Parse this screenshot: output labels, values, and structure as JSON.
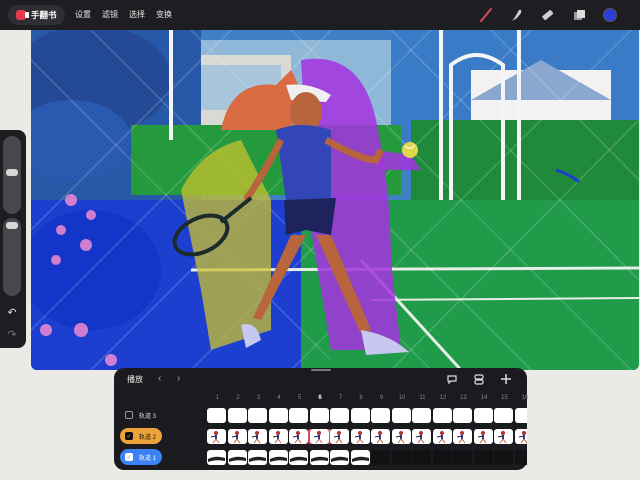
{
  "app": {
    "title": "手翻书"
  },
  "menu": [
    "设置",
    "滤镜",
    "选择",
    "变换"
  ],
  "tools": {
    "brush": {
      "icon": "brush-icon",
      "color": "#e0455e"
    },
    "smudge": {
      "icon": "smudge-icon"
    },
    "eraser": {
      "icon": "eraser-icon"
    },
    "layers": {
      "icon": "layers-icon"
    },
    "color": {
      "icon": "color-swatch",
      "value": "#2b3fd6"
    }
  },
  "timeline": {
    "title": "播放",
    "ruler": [
      "1",
      "2",
      "3",
      "4",
      "5",
      "6",
      "7",
      "8",
      "9",
      "10",
      "11",
      "12",
      "13",
      "14",
      "15",
      "16"
    ],
    "current_frame": "6",
    "tracks": [
      {
        "label": "轨道 3",
        "checked": false,
        "style": "plain",
        "frames": "white",
        "count": 16
      },
      {
        "label": "轨道 2",
        "checked": true,
        "style": "orange",
        "frames": "figure",
        "count": 16
      },
      {
        "label": "轨道 1",
        "checked": true,
        "style": "blue",
        "frames": "stroke",
        "count": 8
      }
    ]
  },
  "colors": {
    "accent_orange": "#eda33a",
    "accent_blue": "#3b82f6",
    "panel": "#1b1b1f",
    "topbar": "#1e1e22"
  }
}
